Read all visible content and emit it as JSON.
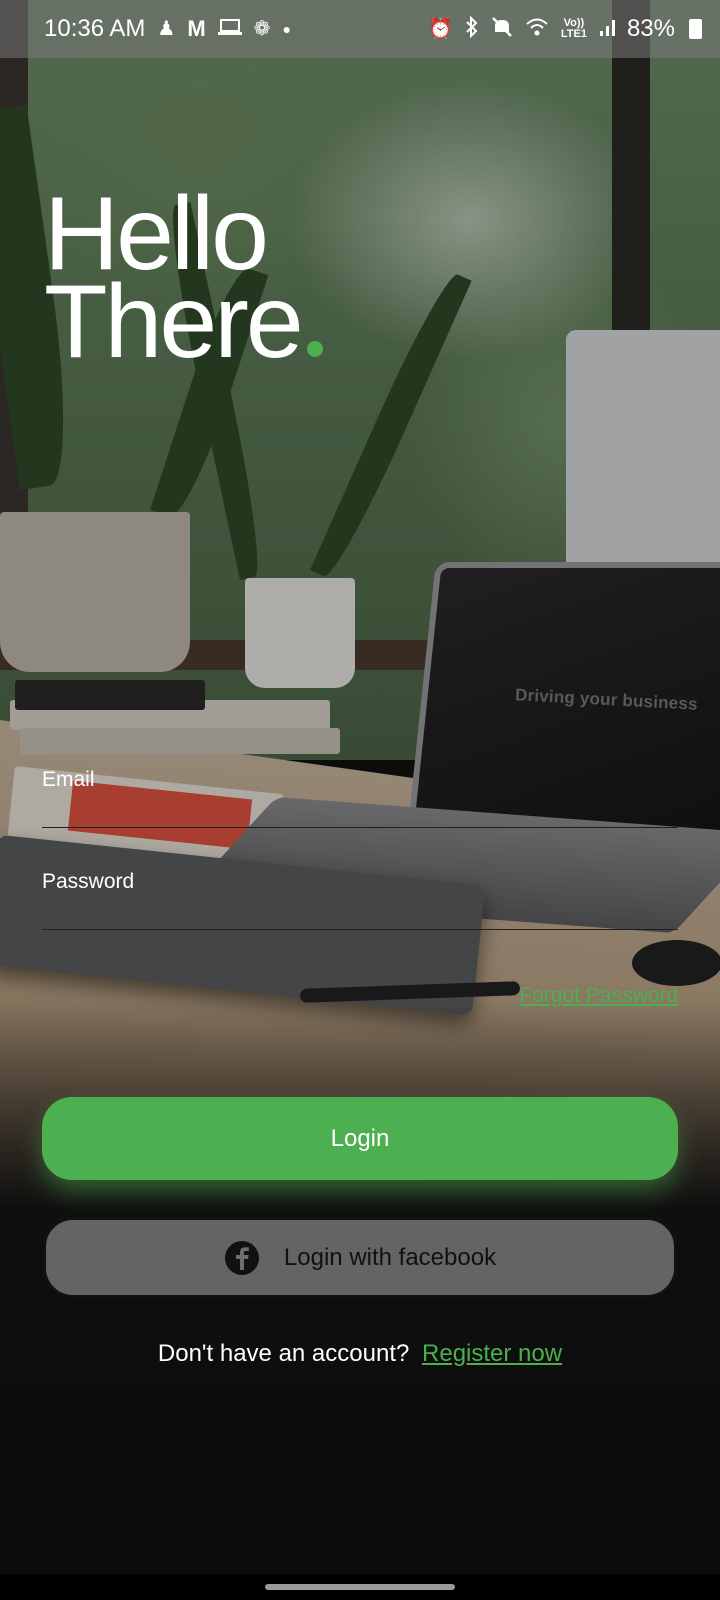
{
  "status_bar": {
    "time": "10:36 AM",
    "net_top": "Vo))",
    "net_bottom": "LTE1",
    "battery": "83%",
    "icons": [
      "person-icon",
      "m-app-icon",
      "laptop-icon",
      "fan-icon",
      "dot-icon",
      "alarm-icon",
      "bluetooth-icon",
      "mute-icon",
      "wifi-icon",
      "signal-icon",
      "battery-icon"
    ]
  },
  "title": {
    "line1": "Hello",
    "line2": "There",
    "accent": "#4caf50"
  },
  "background": {
    "laptop_screen_text": "Driving your business"
  },
  "form": {
    "email_label": "Email",
    "email_value": "",
    "password_label": "Password",
    "password_value": "",
    "forgot_label": "Forgot Password"
  },
  "buttons": {
    "login_label": "Login",
    "facebook_label": "Login with facebook"
  },
  "register": {
    "prompt": "Don't have an account?",
    "link": "Register now"
  },
  "colors": {
    "primary": "#4caf50",
    "facebook_button_bg": "#6e6e6e"
  }
}
